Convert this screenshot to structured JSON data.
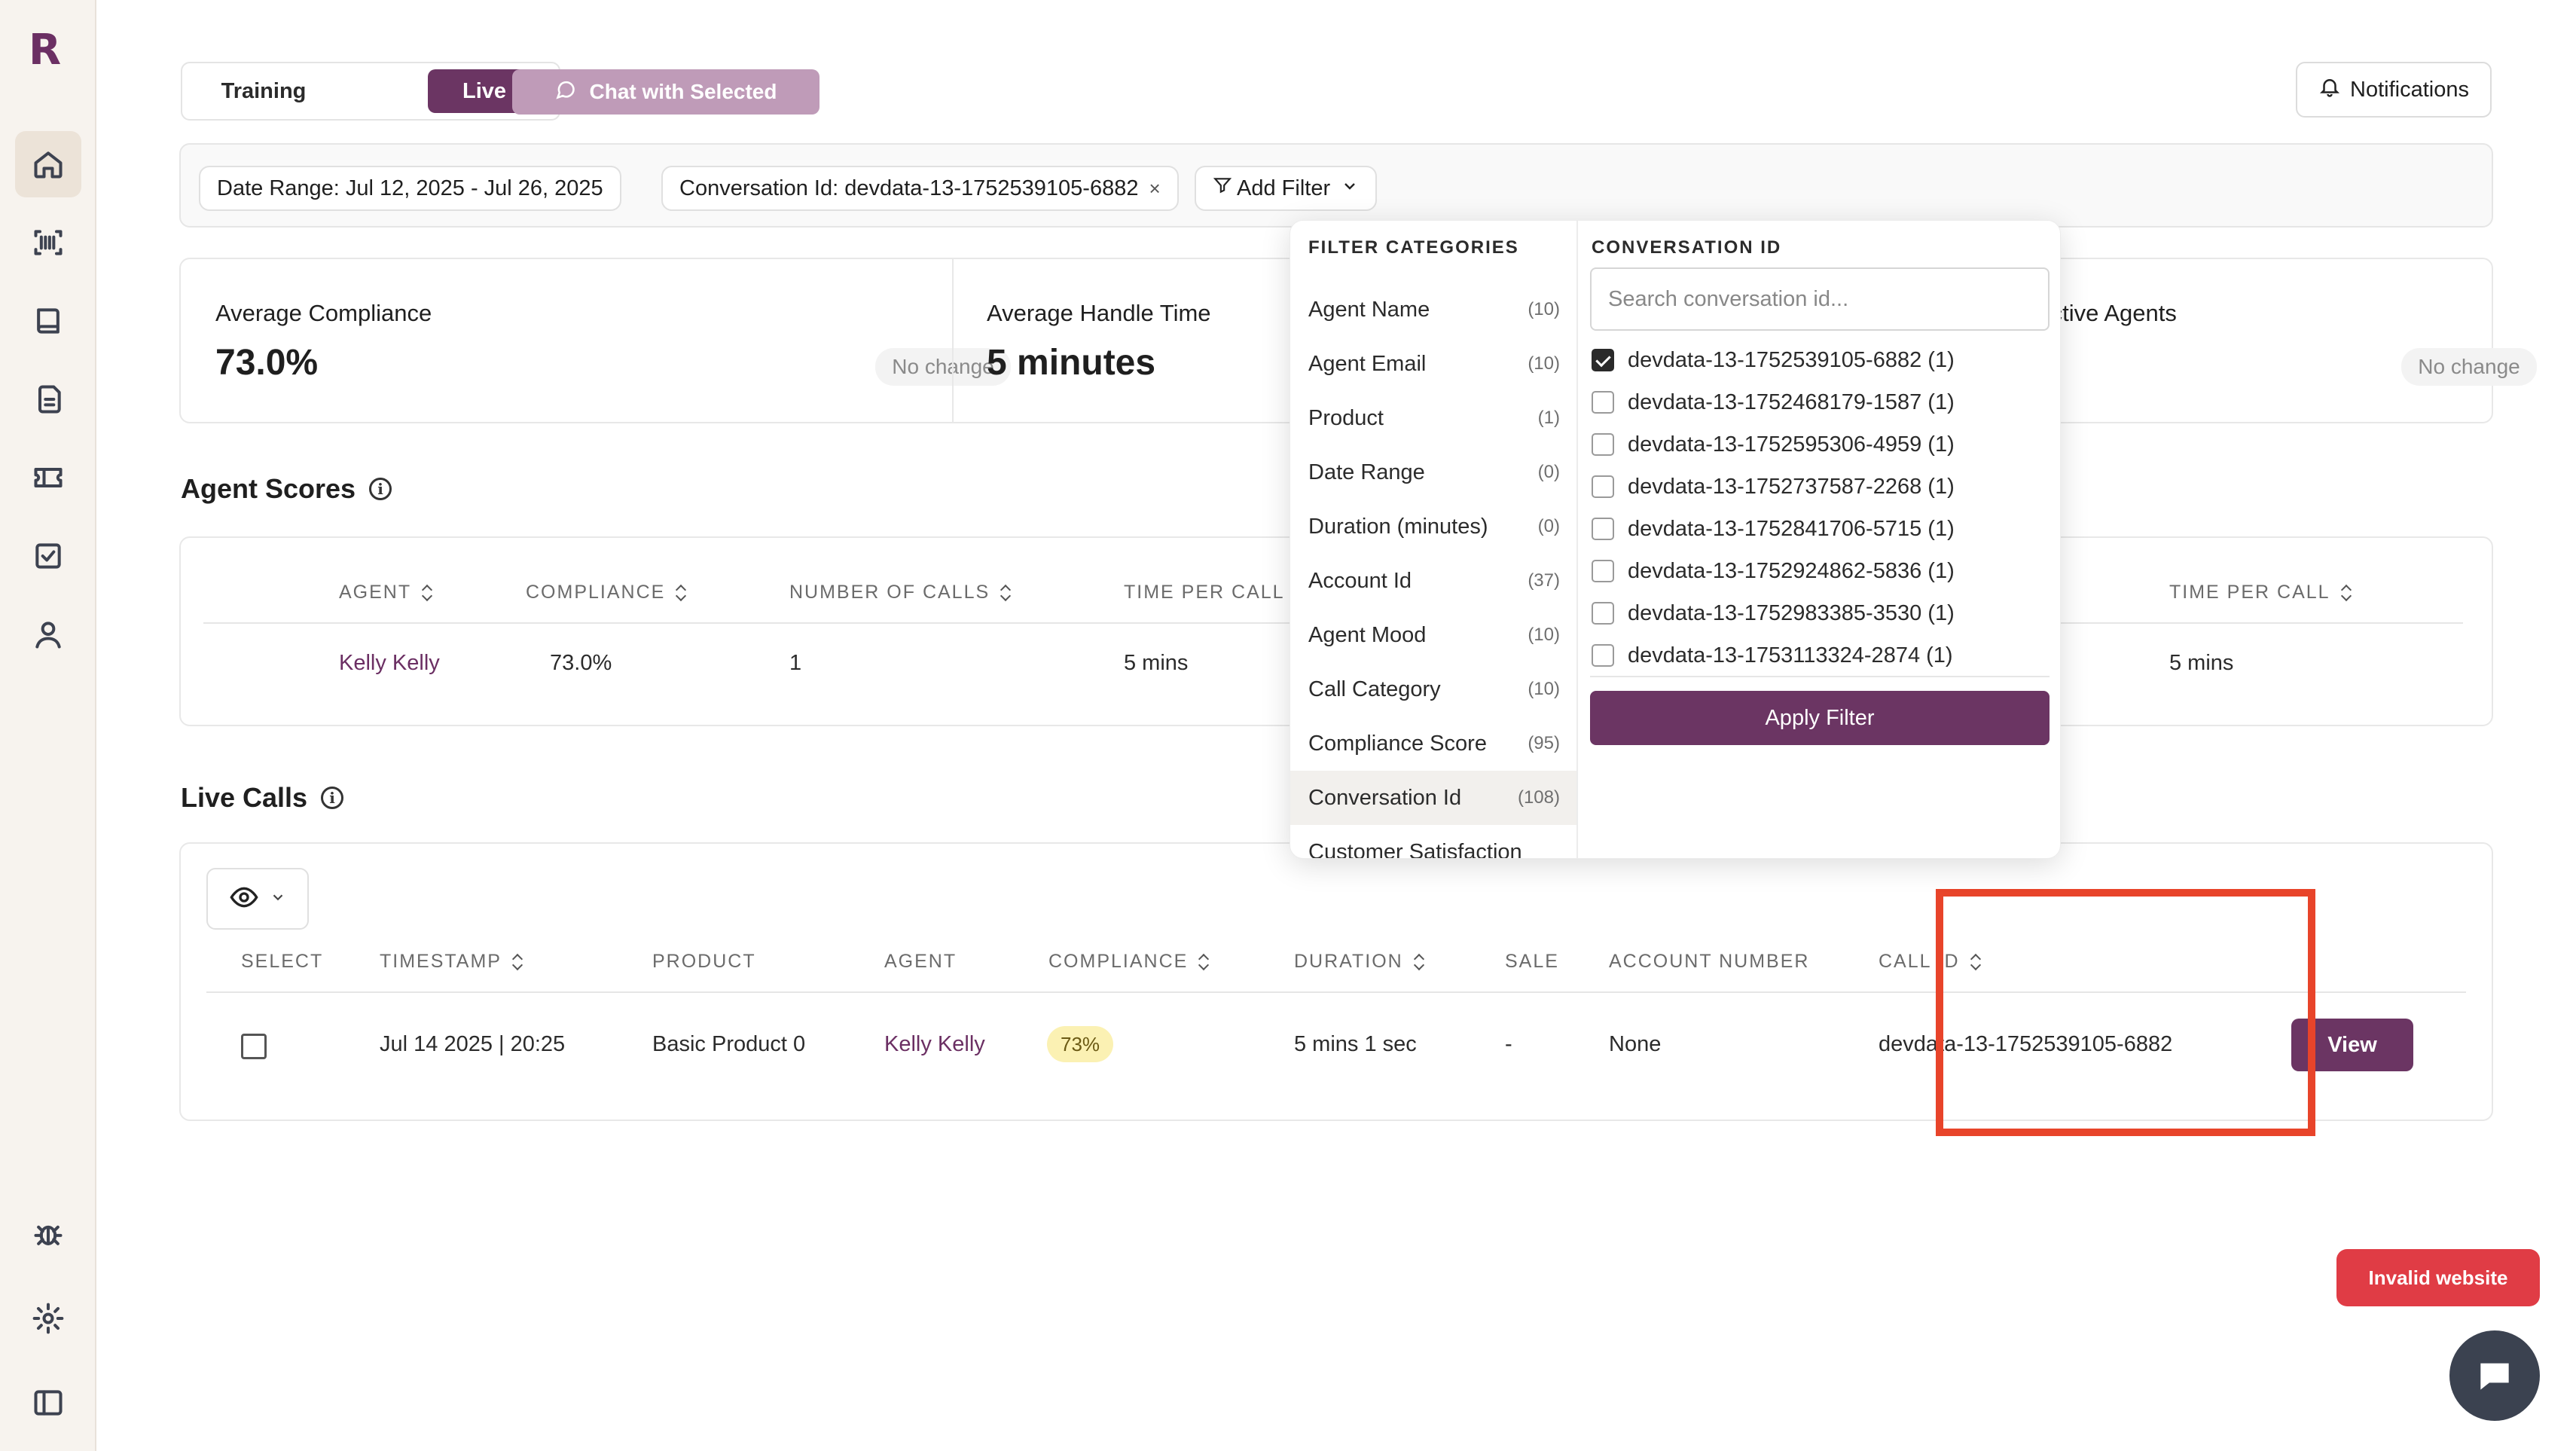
{
  "app": {
    "logo_letter": "R"
  },
  "sidebar": {
    "items": [
      {
        "name": "home-icon"
      },
      {
        "name": "barcode-icon"
      },
      {
        "name": "book-icon"
      },
      {
        "name": "documents-icon"
      },
      {
        "name": "ticket-icon"
      },
      {
        "name": "checklist-icon"
      },
      {
        "name": "user-icon"
      }
    ],
    "bottom_items": [
      {
        "name": "bug-icon"
      },
      {
        "name": "gear-icon"
      },
      {
        "name": "sidebar-toggle-icon"
      }
    ]
  },
  "header": {
    "mode_training": "Training",
    "mode_live": "Live",
    "chat_selected_label": "Chat with Selected",
    "notifications_label": "Notifications"
  },
  "filters": {
    "date_range_chip": "Date Range: Jul 12, 2025 - Jul 26, 2025",
    "conversation_chip": "Conversation Id: devdata-13-1752539105-6882",
    "add_filter_label": "Add Filter"
  },
  "stats": {
    "avg_compliance_label": "Average Compliance",
    "avg_compliance_value": "73.0%",
    "avg_compliance_change": "No change",
    "avg_handle_label": "Average Handle Time",
    "avg_handle_value": "5 minutes",
    "active_agents_label": "Active Agents",
    "active_agents_change": "No change"
  },
  "agent_scores": {
    "title": "Agent Scores",
    "columns": [
      "AGENT",
      "COMPLIANCE",
      "NUMBER OF CALLS",
      "TIME PER CALL",
      "TIME PER CALL"
    ],
    "row": {
      "agent": "Kelly Kelly",
      "compliance": "73.0%",
      "calls": "1",
      "time_per_call": "5 mins",
      "time_per_call_2": "5 mins"
    }
  },
  "live_calls": {
    "title": "Live Calls",
    "columns": [
      "SELECT",
      "TIMESTAMP",
      "PRODUCT",
      "AGENT",
      "COMPLIANCE",
      "DURATION",
      "SALE",
      "ACCOUNT NUMBER",
      "CALL ID"
    ],
    "row": {
      "timestamp": "Jul 14 2025 | 20:25",
      "product": "Basic Product 0",
      "agent": "Kelly Kelly",
      "compliance": "73%",
      "duration": "5 mins 1 sec",
      "sale": "-",
      "account_number": "None",
      "call_id": "devdata-13-1752539105-6882",
      "view_label": "View"
    }
  },
  "filter_dropdown": {
    "categories_heading": "FILTER CATEGORIES",
    "categories": [
      {
        "name": "Agent Name",
        "count": "(10)"
      },
      {
        "name": "Agent Email",
        "count": "(10)"
      },
      {
        "name": "Product",
        "count": "(1)"
      },
      {
        "name": "Date Range",
        "count": "(0)"
      },
      {
        "name": "Duration (minutes)",
        "count": "(0)"
      },
      {
        "name": "Account Id",
        "count": "(37)"
      },
      {
        "name": "Agent Mood",
        "count": "(10)"
      },
      {
        "name": "Call Category",
        "count": "(10)"
      },
      {
        "name": "Compliance Score",
        "count": "(95)"
      },
      {
        "name": "Conversation Id",
        "count": "(108)"
      },
      {
        "name": "Customer Satisfaction",
        "count": ""
      }
    ],
    "options_heading": "CONVERSATION ID",
    "search_placeholder": "Search conversation id...",
    "options": [
      {
        "label": "devdata-13-1752539105-6882 (1)",
        "checked": true
      },
      {
        "label": "devdata-13-1752468179-1587 (1)",
        "checked": false
      },
      {
        "label": "devdata-13-1752595306-4959 (1)",
        "checked": false
      },
      {
        "label": "devdata-13-1752737587-2268 (1)",
        "checked": false
      },
      {
        "label": "devdata-13-1752841706-5715 (1)",
        "checked": false
      },
      {
        "label": "devdata-13-1752924862-5836 (1)",
        "checked": false
      },
      {
        "label": "devdata-13-1752983385-3530 (1)",
        "checked": false
      },
      {
        "label": "devdata-13-1753113324-2874 (1)",
        "checked": false
      }
    ],
    "apply_label": "Apply Filter"
  },
  "floating": {
    "invalid_label": "Invalid website"
  },
  "colors": {
    "brand": "#6b3563",
    "brand_light": "#bf9bb8",
    "highlight": "#e8442a",
    "badge_yellow": "#fbf1b3",
    "invalid_red": "#e03c45"
  }
}
